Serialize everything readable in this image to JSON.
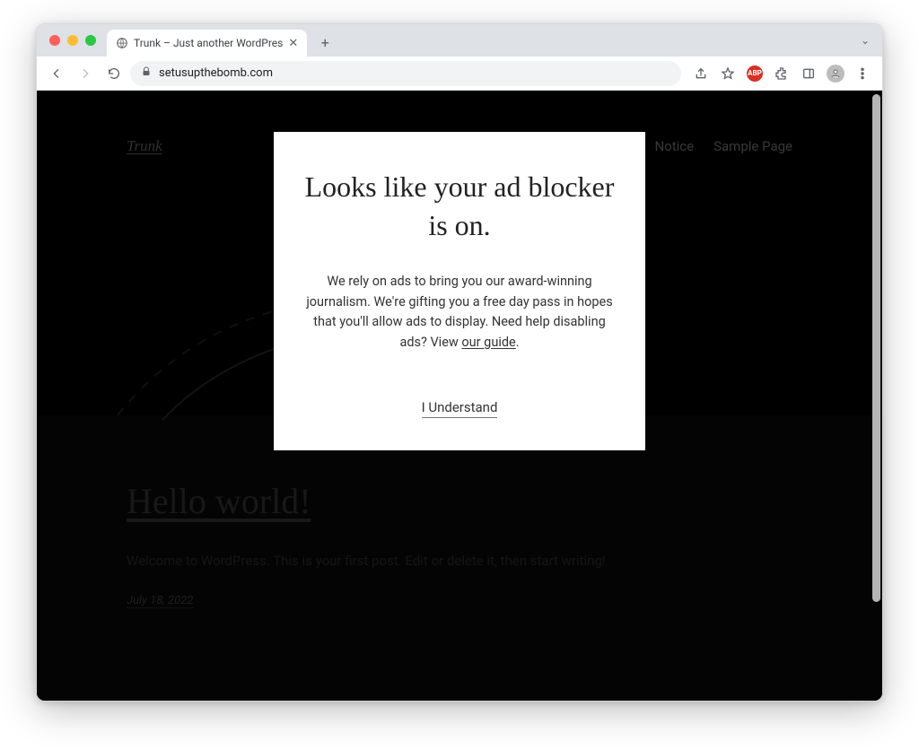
{
  "browser": {
    "tab_title": "Trunk – Just another WordPres",
    "url": "setusupthebomb.com"
  },
  "ext_badge_text": "ABP",
  "site": {
    "title": "Trunk",
    "nav": [
      "Notice",
      "Sample Page"
    ]
  },
  "post": {
    "title": "Hello world!",
    "excerpt": "Welcome to WordPress. This is your first post. Edit or delete it, then start writing!",
    "date": "July 18, 2022"
  },
  "modal": {
    "heading": "Looks like your ad blocker is on.",
    "body_pre": "We rely on ads to bring you our award-winning journalism. We're gifting you a free day pass in hopes that you'll allow ads to display. Need help disabling ads? View ",
    "guide_text": "our guide",
    "body_post": ".",
    "button": "I Understand"
  }
}
